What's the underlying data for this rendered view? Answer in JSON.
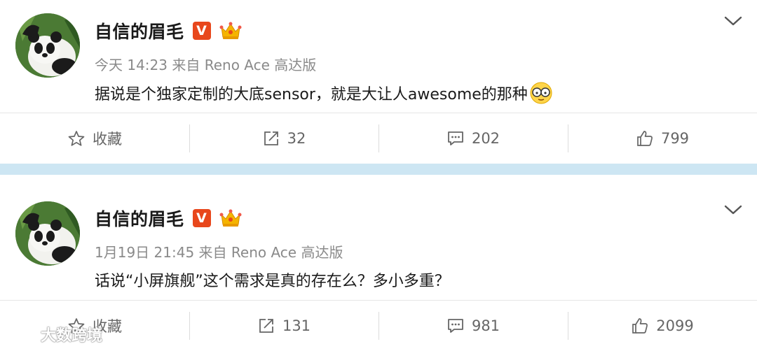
{
  "posts": [
    {
      "user_name": "自信的眉毛",
      "vip_badge": "V",
      "timestamp": "今天 14:23",
      "source": "来自 Reno Ace 高达版",
      "content": "据说是个独家定制的大底sensor，就是大让人awesome的那种",
      "actions": {
        "favorite_label": "收藏",
        "repost_count": "32",
        "comment_count": "202",
        "like_count": "799"
      }
    },
    {
      "user_name": "自信的眉毛",
      "vip_badge": "V",
      "timestamp": "1月19日 21:45",
      "source": "来自 Reno Ace 高达版",
      "content": "话说“小屏旗舰”这个需求是真的存在么？多小多重？",
      "actions": {
        "favorite_label": "收藏",
        "repost_count": "131",
        "comment_count": "981",
        "like_count": "2099"
      }
    }
  ],
  "watermark": {
    "text": "大数跨境"
  },
  "colors": {
    "divider_band": "#cde6f3",
    "vip_badge": "#e8471c",
    "meta_text": "#8a8a8a",
    "action_text": "#666666"
  },
  "icons": {
    "avatar": "panda-avatar",
    "crown": "crown-icon",
    "more": "chevron-down-icon",
    "favorite": "star-icon",
    "repost": "repost-icon",
    "comment": "comment-icon",
    "like": "thumbs-up-icon",
    "emoji": "glasses-emoji"
  }
}
